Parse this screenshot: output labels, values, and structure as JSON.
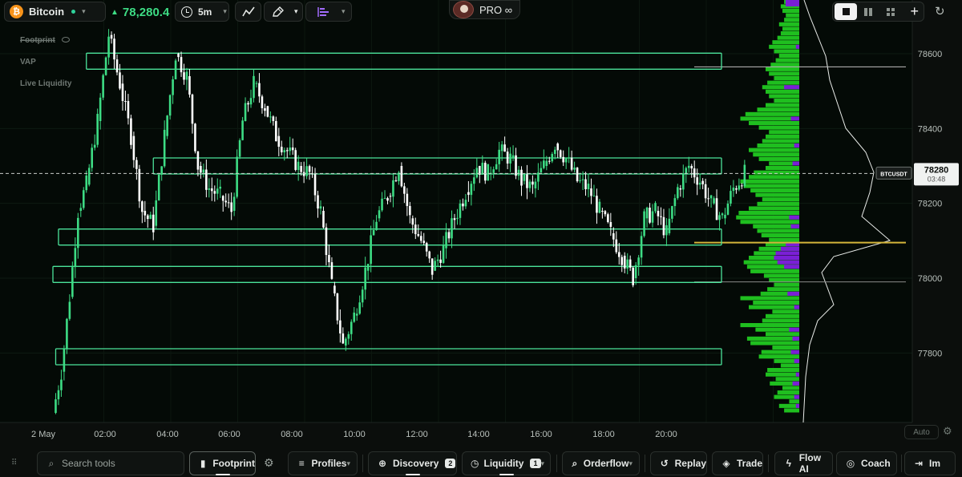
{
  "topbar": {
    "symbol": "Bitcoin",
    "symbol_icon": "btc-coin-icon",
    "last_price": "78,280.4",
    "timeframe": "5m",
    "pro_label": "PRO ∞"
  },
  "legend": {
    "footprint": "Footprint",
    "vap": "VAP",
    "live_liquidity": "Live Liquidity"
  },
  "price_tag": {
    "symbol": "BTCUSDT",
    "price": "78280",
    "countdown": "03:48"
  },
  "bottombar": {
    "search_placeholder": "Search tools",
    "footprint": "Footprint",
    "profiles": "Profiles",
    "discovery": "Discovery",
    "discovery_count": "2",
    "liquidity": "Liquidity",
    "liquidity_count": "1",
    "orderflow": "Orderflow",
    "replay": "Replay",
    "trade": "Trade",
    "flow_ai": "Flow AI",
    "coach": "Coach",
    "import": "Im"
  },
  "auto_label": "Auto",
  "colors": {
    "bull": "#3ddc84",
    "bear": "#ffffff",
    "zone": "#4be39a",
    "buy_volume": "#1fbf1f",
    "sell_volume": "#7a1fd6",
    "poc": "#d4b53a",
    "background": "#040a06"
  },
  "chart_data": {
    "type": "candlestick",
    "title": "",
    "x_axis_labels": [
      "2 May",
      "02:00",
      "04:00",
      "06:00",
      "08:00",
      "10:00",
      "12:00",
      "14:00",
      "16:00",
      "18:00",
      "20:00"
    ],
    "y_axis_ticks": [
      77800,
      78000,
      78200,
      78400,
      78600
    ],
    "ylim": [
      77620,
      78780
    ],
    "current_price": 78280,
    "price_path": [
      [
        "00:00",
        77640
      ],
      [
        "00:15",
        77750
      ],
      [
        "00:30",
        77950
      ],
      [
        "00:45",
        78180
      ],
      [
        "01:00",
        78250
      ],
      [
        "01:20",
        78420
      ],
      [
        "01:40",
        78650
      ],
      [
        "02:00",
        78520
      ],
      [
        "02:20",
        78380
      ],
      [
        "02:40",
        78180
      ],
      [
        "03:00",
        78140
      ],
      [
        "03:20",
        78380
      ],
      [
        "03:40",
        78600
      ],
      [
        "04:00",
        78540
      ],
      [
        "04:20",
        78300
      ],
      [
        "04:40",
        78240
      ],
      [
        "05:00",
        78220
      ],
      [
        "05:20",
        78180
      ],
      [
        "05:40",
        78420
      ],
      [
        "06:00",
        78520
      ],
      [
        "06:20",
        78460
      ],
      [
        "06:40",
        78380
      ],
      [
        "07:00",
        78340
      ],
      [
        "07:20",
        78300
      ],
      [
        "07:40",
        78280
      ],
      [
        "08:00",
        78180
      ],
      [
        "08:20",
        77980
      ],
      [
        "08:40",
        77820
      ],
      [
        "09:00",
        77900
      ],
      [
        "09:20",
        78020
      ],
      [
        "09:40",
        78160
      ],
      [
        "10:00",
        78220
      ],
      [
        "10:20",
        78300
      ],
      [
        "10:40",
        78160
      ],
      [
        "11:00",
        78100
      ],
      [
        "11:20",
        78020
      ],
      [
        "11:40",
        78080
      ],
      [
        "12:00",
        78160
      ],
      [
        "12:20",
        78230
      ],
      [
        "12:40",
        78300
      ],
      [
        "13:00",
        78280
      ],
      [
        "13:20",
        78340
      ],
      [
        "13:40",
        78320
      ],
      [
        "14:00",
        78260
      ],
      [
        "14:20",
        78240
      ],
      [
        "14:40",
        78300
      ],
      [
        "15:00",
        78360
      ],
      [
        "15:20",
        78320
      ],
      [
        "15:40",
        78260
      ],
      [
        "16:00",
        78240
      ],
      [
        "16:20",
        78180
      ],
      [
        "16:40",
        78120
      ],
      [
        "17:00",
        78060
      ],
      [
        "17:20",
        78000
      ],
      [
        "17:40",
        78160
      ],
      [
        "18:00",
        78180
      ],
      [
        "18:20",
        78120
      ],
      [
        "18:40",
        78240
      ],
      [
        "19:00",
        78300
      ],
      [
        "19:20",
        78260
      ],
      [
        "19:40",
        78200
      ],
      [
        "20:00",
        78160
      ],
      [
        "20:20",
        78240
      ],
      [
        "20:40",
        78280
      ]
    ],
    "zones": [
      {
        "from": "01:00",
        "to": "22:00",
        "low": 78565,
        "high": 78595
      },
      {
        "from": "03:00",
        "to": "22:00",
        "low": 78285,
        "high": 78315
      },
      {
        "from": "00:10",
        "to": "22:00",
        "low": 78095,
        "high": 78125
      },
      {
        "from": "00:00",
        "to": "22:00",
        "low": 77995,
        "high": 78025
      },
      {
        "from": "00:05",
        "to": "22:00",
        "low": 77775,
        "high": 77805
      }
    ],
    "levels": [
      {
        "price": 78565,
        "color": "#bfbfbf"
      },
      {
        "price": 78095,
        "color": "#d4b53a"
      },
      {
        "price": 77990,
        "color": "#8a8a8a"
      }
    ],
    "volume_profile": {
      "price_step": 12,
      "start_price": 77640,
      "buy": [
        18,
        24,
        12,
        30,
        26,
        20,
        35,
        28,
        40,
        38,
        22,
        30,
        48,
        45,
        32,
        58,
        62,
        40,
        52,
        70,
        44,
        40,
        32,
        60,
        55,
        70,
        46,
        38,
        30,
        36,
        42,
        58,
        62,
        66,
        60,
        54,
        48,
        40,
        36,
        45,
        50,
        55,
        70,
        75,
        72,
        60,
        50,
        44,
        52,
        58,
        66,
        70,
        60,
        54,
        40,
        36,
        48,
        55,
        60,
        50,
        44,
        40,
        36,
        48,
        60,
        70,
        64,
        50,
        40,
        30,
        36,
        40,
        44,
        38,
        30,
        36,
        40,
        34,
        28,
        24,
        30,
        36,
        32,
        26,
        22,
        20,
        24,
        18,
        16,
        20,
        22,
        18,
        14,
        12
      ],
      "sell": [
        0,
        4,
        0,
        6,
        0,
        0,
        8,
        0,
        4,
        0,
        0,
        6,
        0,
        10,
        0,
        0,
        8,
        0,
        12,
        0,
        0,
        0,
        0,
        6,
        0,
        0,
        14,
        0,
        0,
        0,
        0,
        0,
        18,
        26,
        30,
        28,
        22,
        16,
        0,
        0,
        0,
        10,
        0,
        12,
        0,
        0,
        0,
        0,
        0,
        0,
        0,
        0,
        0,
        0,
        0,
        8,
        0,
        0,
        0,
        6,
        0,
        0,
        0,
        0,
        0,
        10,
        0,
        0,
        0,
        0,
        0,
        0,
        18,
        0,
        0,
        0,
        0,
        0,
        0,
        0,
        0,
        4,
        0,
        0,
        0,
        0,
        0,
        0,
        0,
        0,
        0,
        0,
        0,
        0
      ]
    }
  }
}
